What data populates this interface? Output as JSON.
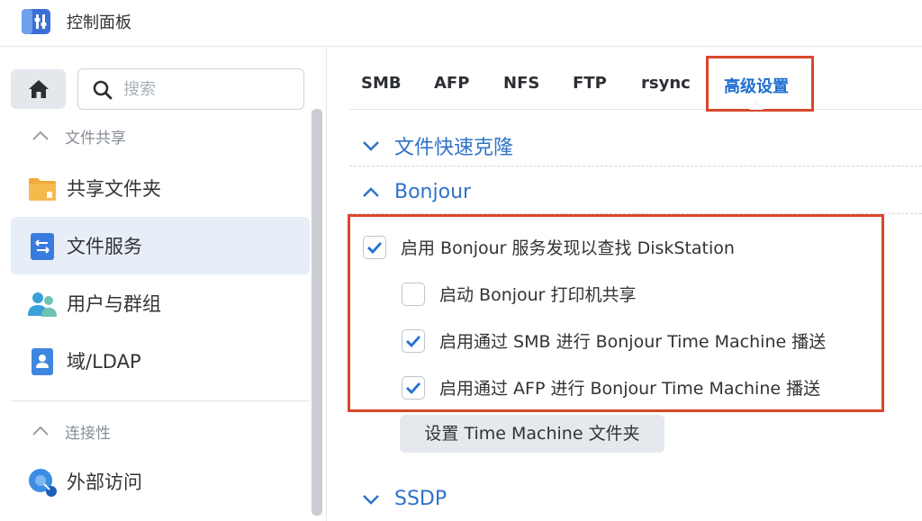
{
  "app": {
    "title": "控制面板"
  },
  "sidebar": {
    "search": {
      "placeholder": "搜索"
    },
    "sections": [
      {
        "label": "文件共享"
      },
      {
        "label": "连接性"
      }
    ],
    "items": [
      {
        "label": "共享文件夹",
        "icon": "folder-icon"
      },
      {
        "label": "文件服务",
        "icon": "file-services-icon"
      },
      {
        "label": "用户与群组",
        "icon": "users-icon"
      },
      {
        "label": "域/LDAP",
        "icon": "domain-ldap-icon"
      },
      {
        "label": "外部访问",
        "icon": "external-access-icon"
      }
    ]
  },
  "tabs": [
    {
      "label": "SMB"
    },
    {
      "label": "AFP"
    },
    {
      "label": "NFS"
    },
    {
      "label": "FTP"
    },
    {
      "label": "rsync"
    },
    {
      "label": "高级设置"
    }
  ],
  "groups": {
    "clone": {
      "title": "文件快速克隆"
    },
    "bonjour": {
      "title": "Bonjour"
    },
    "ssdp": {
      "title": "SSDP"
    }
  },
  "options": [
    {
      "label": "启用 Bonjour 服务发现以查找 DiskStation",
      "checked": true
    },
    {
      "label": "启动 Bonjour 打印机共享",
      "checked": false
    },
    {
      "label": "启用通过 SMB 进行 Bonjour Time Machine 播送",
      "checked": true
    },
    {
      "label": "启用通过 AFP 进行 Bonjour Time Machine 播送",
      "checked": true
    }
  ],
  "buttons": {
    "time_machine": "设置 Time Machine 文件夹"
  },
  "colors": {
    "accent": "#1f6fd1",
    "highlight": "#d9472b",
    "active_bg": "#e7eef8"
  }
}
